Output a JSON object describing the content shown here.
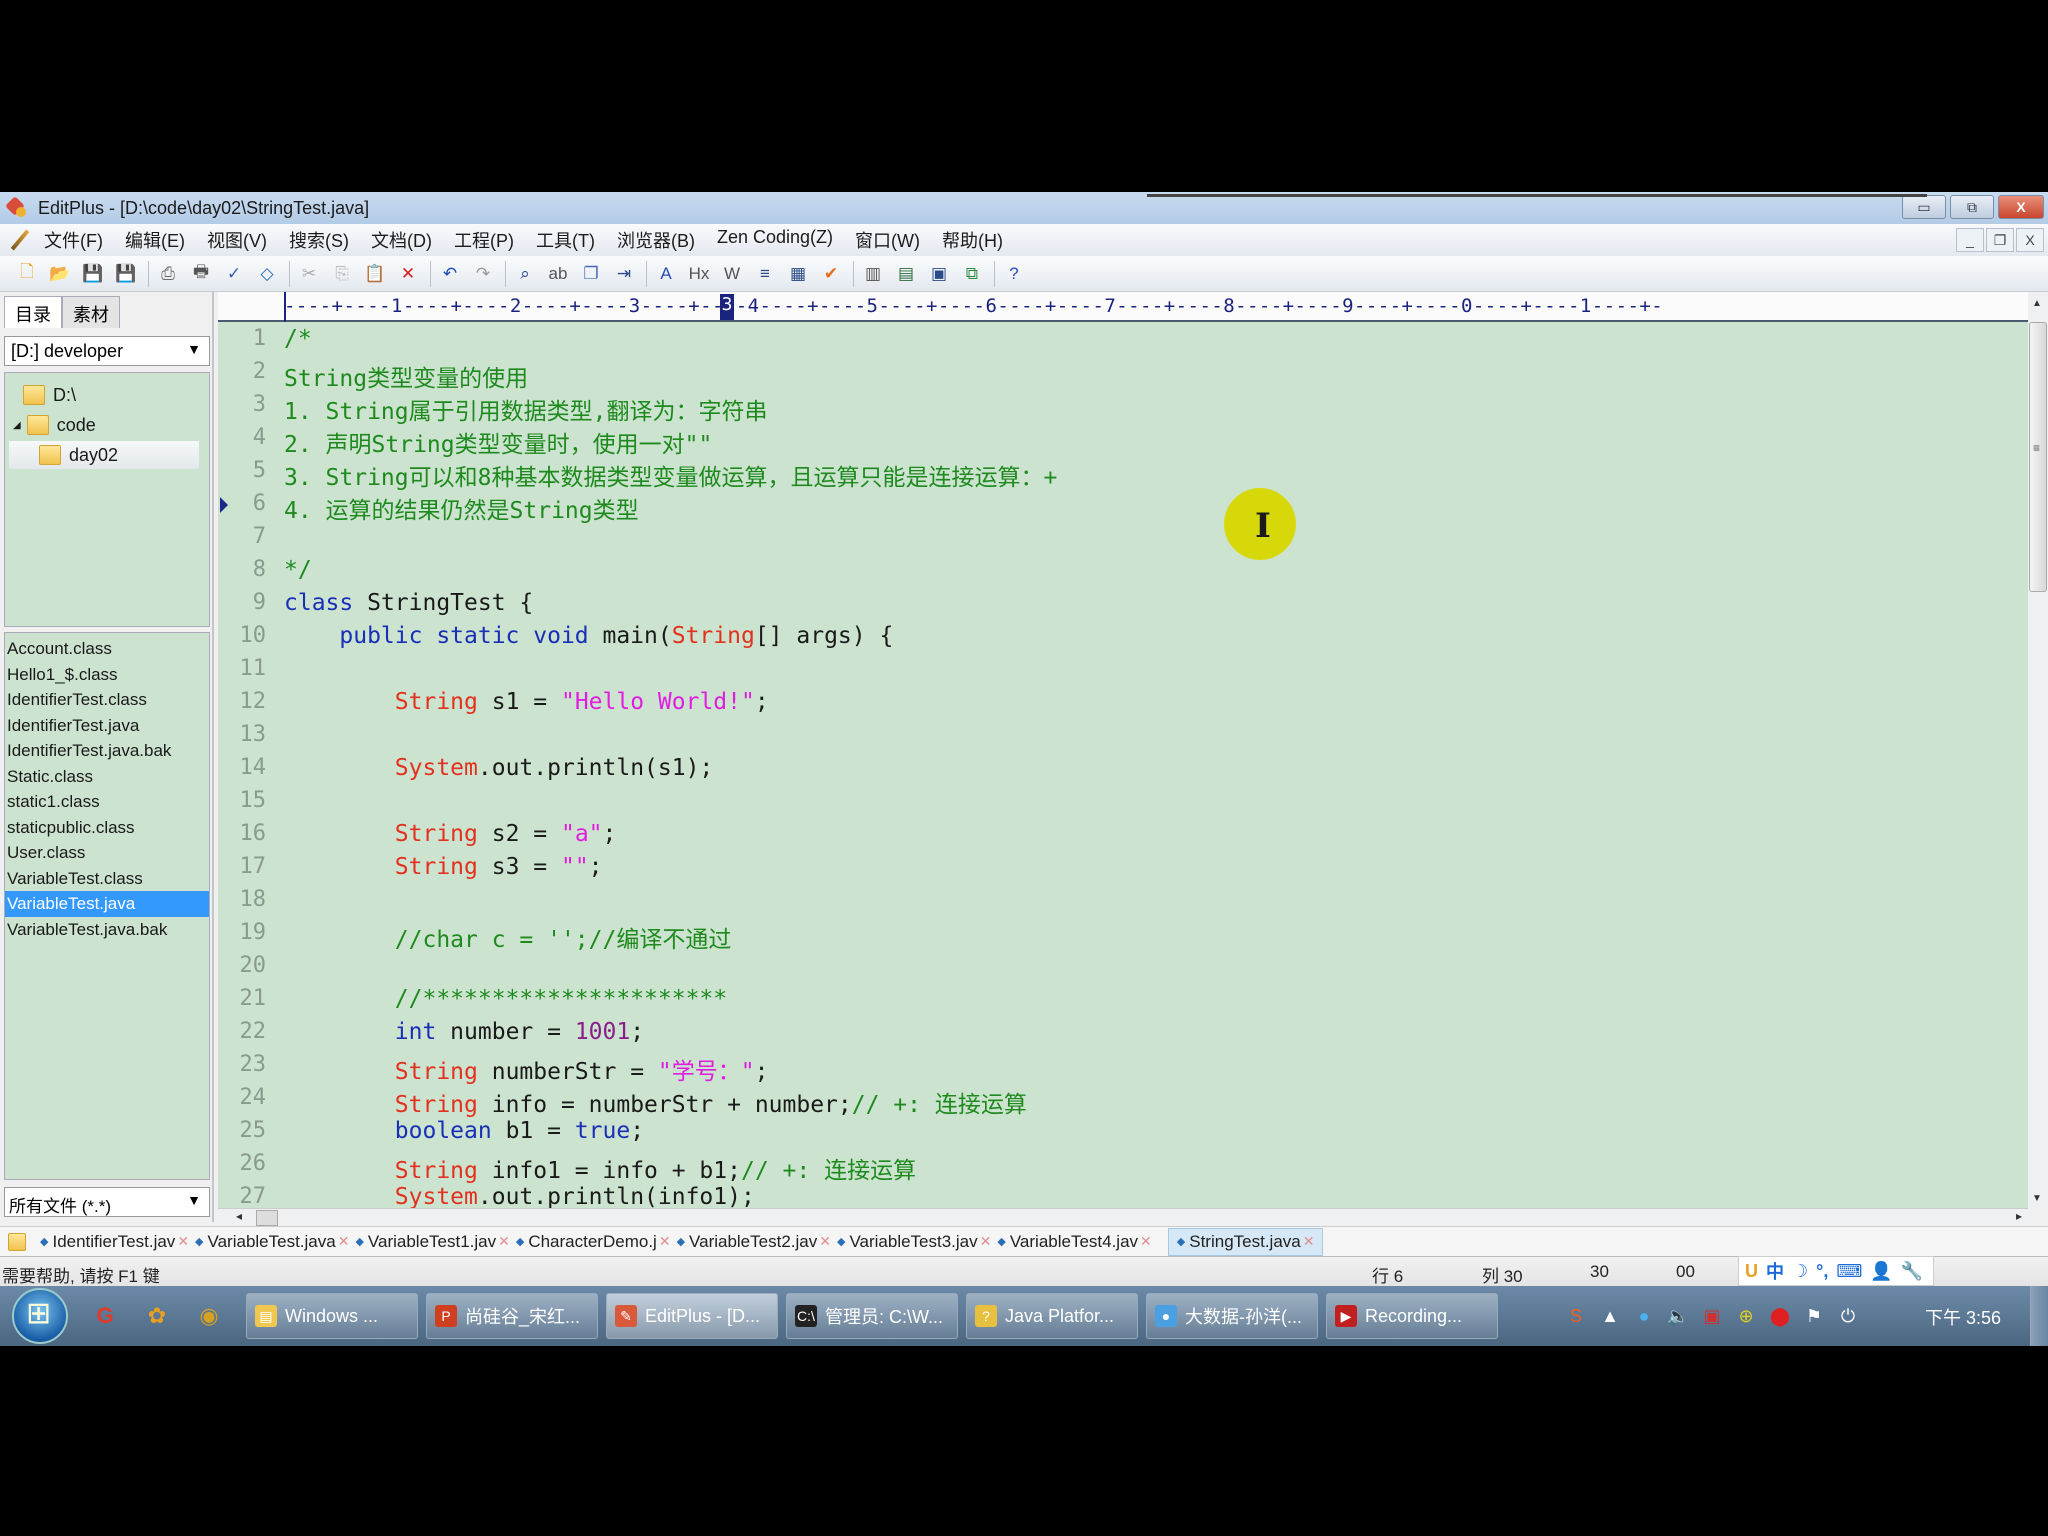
{
  "window": {
    "title": "EditPlus - [D:\\code\\day02\\StringTest.java]",
    "controls": {
      "minimize": "▭",
      "restore": "⧉",
      "close": "X"
    },
    "mdi_controls": {
      "minimize": "_",
      "restore": "❐",
      "close": "X"
    }
  },
  "menu": [
    "文件(F)",
    "编辑(E)",
    "视图(V)",
    "搜索(S)",
    "文档(D)",
    "工程(P)",
    "工具(T)",
    "浏览器(B)",
    "Zen Coding(Z)",
    "窗口(W)",
    "帮助(H)"
  ],
  "toolbar": [
    {
      "icon": "new-file-icon",
      "glyph": "🗋",
      "color": "#e6a820"
    },
    {
      "icon": "open-icon",
      "glyph": "📂",
      "color": "#e6b030"
    },
    {
      "icon": "save-icon",
      "glyph": "💾",
      "color": "#2a7a3a"
    },
    {
      "icon": "save-all-icon",
      "glyph": "💾",
      "color": "#3a8a4a"
    },
    {
      "sep": true
    },
    {
      "icon": "print-preview-icon",
      "glyph": "⎙",
      "color": "#666"
    },
    {
      "icon": "print-icon",
      "glyph": "🖶",
      "color": "#555"
    },
    {
      "icon": "spellcheck-icon",
      "glyph": "✓",
      "color": "#3a5ab8"
    },
    {
      "icon": "browser-preview-icon",
      "glyph": "◇",
      "color": "#2a6ab8"
    },
    {
      "sep": true
    },
    {
      "icon": "cut-icon",
      "glyph": "✂",
      "color": "#aaa"
    },
    {
      "icon": "copy-icon",
      "glyph": "⎘",
      "color": "#bbb"
    },
    {
      "icon": "paste-icon",
      "glyph": "📋",
      "color": "#444"
    },
    {
      "icon": "delete-icon",
      "glyph": "✕",
      "color": "#d02020"
    },
    {
      "sep": true
    },
    {
      "icon": "undo-icon",
      "glyph": "↶",
      "color": "#1a4ab8"
    },
    {
      "icon": "redo-icon",
      "glyph": "↷",
      "color": "#999"
    },
    {
      "sep": true
    },
    {
      "icon": "find-icon",
      "glyph": "⌕",
      "color": "#1a3a8a"
    },
    {
      "icon": "replace-icon",
      "glyph": "ab",
      "color": "#555"
    },
    {
      "icon": "find-in-files-icon",
      "glyph": "❐",
      "color": "#4a6ab8"
    },
    {
      "icon": "goto-line-icon",
      "glyph": "⇥",
      "color": "#2a4a8a"
    },
    {
      "sep": true
    },
    {
      "icon": "font-icon",
      "glyph": "A",
      "color": "#2a4ab8"
    },
    {
      "icon": "hex-icon",
      "glyph": "Hx",
      "color": "#555"
    },
    {
      "icon": "word-wrap-icon",
      "glyph": "W",
      "color": "#555"
    },
    {
      "icon": "line-numbers-icon",
      "glyph": "≡",
      "color": "#2a4a8a"
    },
    {
      "icon": "column-select-icon",
      "glyph": "▦",
      "color": "#2a4a8a"
    },
    {
      "icon": "check-icon",
      "glyph": "✔",
      "color": "#e07020"
    },
    {
      "sep": true
    },
    {
      "icon": "directory-window-icon",
      "glyph": "▥",
      "color": "#555"
    },
    {
      "icon": "cliptext-window-icon",
      "glyph": "▤",
      "color": "#2a6a3a"
    },
    {
      "icon": "output-window-icon",
      "glyph": "▣",
      "color": "#2a4a8a"
    },
    {
      "icon": "fullscreen-icon",
      "glyph": "⧉",
      "color": "#2a8a3a"
    },
    {
      "sep": true
    },
    {
      "icon": "help-icon",
      "glyph": "?",
      "color": "#2a4ab8"
    }
  ],
  "left_panel": {
    "tabs": [
      "目录",
      "素材"
    ],
    "drive": "[D:] developer",
    "tree": [
      {
        "label": "D:\\",
        "level": 0,
        "expanded": false,
        "selected": false
      },
      {
        "label": "code",
        "level": 1,
        "expanded": true,
        "selected": false
      },
      {
        "label": "day02",
        "level": 2,
        "expanded": false,
        "selected": true
      }
    ],
    "files": [
      "Account.class",
      "Hello1_$.class",
      "IdentifierTest.class",
      "IdentifierTest.java",
      "IdentifierTest.java.bak",
      "Static.class",
      "static1.class",
      "staticpublic.class",
      "User.class",
      "VariableTest.class",
      "VariableTest.java",
      "VariableTest.java.bak"
    ],
    "selected_file": "VariableTest.java",
    "filter": "所有文件 (*.*)"
  },
  "ruler": {
    "text": "----+----1----+----2----+----3----+----4----+----5----+----6----+----7----+----8----+----9----+----0----+----1----+-",
    "current_column_mark": "3"
  },
  "editor": {
    "current_line": 6,
    "lines": [
      {
        "n": "1",
        "tokens": [
          {
            "t": "/*",
            "c": "cmt"
          }
        ]
      },
      {
        "n": "2",
        "tokens": [
          {
            "t": "String类型变量的使用",
            "c": "cmt"
          }
        ]
      },
      {
        "n": "3",
        "tokens": [
          {
            "t": "1. String属于引用数据类型,翻译为：字符串",
            "c": "cmt"
          }
        ]
      },
      {
        "n": "4",
        "tokens": [
          {
            "t": "2. 声明String类型变量时，使用一对\"\"",
            "c": "cmt"
          }
        ]
      },
      {
        "n": "5",
        "tokens": [
          {
            "t": "3. String可以和8种基本数据类型变量做运算，且运算只能是连接运算：+",
            "c": "cmt"
          }
        ]
      },
      {
        "n": "6",
        "tokens": [
          {
            "t": "4. 运算的结果仍然是String类型",
            "c": "cmt"
          }
        ]
      },
      {
        "n": "7",
        "tokens": []
      },
      {
        "n": "8",
        "tokens": [
          {
            "t": "*/",
            "c": "cmt"
          }
        ]
      },
      {
        "n": "9",
        "tokens": [
          {
            "t": "class",
            "c": "kw"
          },
          {
            "t": " StringTest {",
            "c": "plain"
          }
        ]
      },
      {
        "n": "10",
        "tokens": [
          {
            "t": "    ",
            "c": "plain"
          },
          {
            "t": "public static void",
            "c": "kw"
          },
          {
            "t": " main(",
            "c": "plain"
          },
          {
            "t": "String",
            "c": "ty"
          },
          {
            "t": "[] args) {",
            "c": "plain"
          }
        ]
      },
      {
        "n": "11",
        "tokens": []
      },
      {
        "n": "12",
        "tokens": [
          {
            "t": "        ",
            "c": "plain"
          },
          {
            "t": "String",
            "c": "ty"
          },
          {
            "t": " s1 = ",
            "c": "plain"
          },
          {
            "t": "\"Hello World!\"",
            "c": "str"
          },
          {
            "t": ";",
            "c": "plain"
          }
        ]
      },
      {
        "n": "13",
        "tokens": []
      },
      {
        "n": "14",
        "tokens": [
          {
            "t": "        ",
            "c": "plain"
          },
          {
            "t": "System",
            "c": "ty"
          },
          {
            "t": ".out.println(s1);",
            "c": "plain"
          }
        ]
      },
      {
        "n": "15",
        "tokens": []
      },
      {
        "n": "16",
        "tokens": [
          {
            "t": "        ",
            "c": "plain"
          },
          {
            "t": "String",
            "c": "ty"
          },
          {
            "t": " s2 = ",
            "c": "plain"
          },
          {
            "t": "\"a\"",
            "c": "str"
          },
          {
            "t": ";",
            "c": "plain"
          }
        ]
      },
      {
        "n": "17",
        "tokens": [
          {
            "t": "        ",
            "c": "plain"
          },
          {
            "t": "String",
            "c": "ty"
          },
          {
            "t": " s3 = ",
            "c": "plain"
          },
          {
            "t": "\"\"",
            "c": "str"
          },
          {
            "t": ";",
            "c": "plain"
          }
        ]
      },
      {
        "n": "18",
        "tokens": []
      },
      {
        "n": "19",
        "tokens": [
          {
            "t": "        ",
            "c": "plain"
          },
          {
            "t": "//char c = '';//编译不通过",
            "c": "cmt"
          }
        ]
      },
      {
        "n": "20",
        "tokens": []
      },
      {
        "n": "21",
        "tokens": [
          {
            "t": "        ",
            "c": "plain"
          },
          {
            "t": "//**********************",
            "c": "cmt"
          }
        ]
      },
      {
        "n": "22",
        "tokens": [
          {
            "t": "        ",
            "c": "plain"
          },
          {
            "t": "int",
            "c": "kw"
          },
          {
            "t": " number = ",
            "c": "plain"
          },
          {
            "t": "1001",
            "c": "num"
          },
          {
            "t": ";",
            "c": "plain"
          }
        ]
      },
      {
        "n": "23",
        "tokens": [
          {
            "t": "        ",
            "c": "plain"
          },
          {
            "t": "String",
            "c": "ty"
          },
          {
            "t": " numberStr = ",
            "c": "plain"
          },
          {
            "t": "\"学号：\"",
            "c": "str"
          },
          {
            "t": ";",
            "c": "plain"
          }
        ]
      },
      {
        "n": "24",
        "tokens": [
          {
            "t": "        ",
            "c": "plain"
          },
          {
            "t": "String",
            "c": "ty"
          },
          {
            "t": " info = numberStr + number;",
            "c": "plain"
          },
          {
            "t": "// +: 连接运算",
            "c": "cmt"
          }
        ]
      },
      {
        "n": "25",
        "tokens": [
          {
            "t": "        ",
            "c": "plain"
          },
          {
            "t": "boolean",
            "c": "kw"
          },
          {
            "t": " b1 = ",
            "c": "plain"
          },
          {
            "t": "true",
            "c": "kw"
          },
          {
            "t": ";",
            "c": "plain"
          }
        ]
      },
      {
        "n": "26",
        "tokens": [
          {
            "t": "        ",
            "c": "plain"
          },
          {
            "t": "String",
            "c": "ty"
          },
          {
            "t": " info1 = info + b1;",
            "c": "plain"
          },
          {
            "t": "// +: 连接运算",
            "c": "cmt"
          }
        ]
      },
      {
        "n": "27",
        "tokens": [
          {
            "t": "        ",
            "c": "plain"
          },
          {
            "t": "System",
            "c": "ty"
          },
          {
            "t": ".out.println(info1);",
            "c": "plain"
          }
        ]
      }
    ]
  },
  "doc_tabs": [
    {
      "label": "IdentifierTest.jav",
      "active": false
    },
    {
      "label": "VariableTest.java",
      "active": false
    },
    {
      "label": "VariableTest1.jav",
      "active": false
    },
    {
      "label": "CharacterDemo.j",
      "active": false
    },
    {
      "label": "VariableTest2.jav",
      "active": false
    },
    {
      "label": "VariableTest3.jav",
      "active": false
    },
    {
      "label": "VariableTest4.jav",
      "active": false
    },
    {
      "label": "StringTest.java",
      "active": true
    }
  ],
  "status": {
    "help": "需要帮助, 请按 F1 键",
    "line": "行 6",
    "col": "列 30",
    "sel": "30",
    "code": "00"
  },
  "ime": [
    "U",
    "中",
    "☽",
    "°,",
    "⌨",
    "👤",
    "🔧"
  ],
  "taskbar": {
    "quick_launch": [
      {
        "name": "quick-launch-app-1",
        "glyph": "G",
        "color": "#e03a2a"
      },
      {
        "name": "quick-launch-app-2",
        "glyph": "✿",
        "color": "#e8a020"
      },
      {
        "name": "chrome-icon",
        "glyph": "◉",
        "color": "#d8a020"
      }
    ],
    "tasks": [
      {
        "label": "Windows ...",
        "icon": "folder-icon",
        "glyph": "▤",
        "bg": "#f0c850",
        "active": false
      },
      {
        "label": "尚硅谷_宋红...",
        "icon": "powerpoint-icon",
        "glyph": "P",
        "bg": "#d04020",
        "active": false
      },
      {
        "label": "EditPlus - [D...",
        "icon": "editplus-icon",
        "glyph": "✎",
        "bg": "#d85a3a",
        "active": true
      },
      {
        "label": "管理员: C:\\W...",
        "icon": "cmd-icon",
        "glyph": "C:\\",
        "bg": "#222",
        "active": false
      },
      {
        "label": "Java Platfor...",
        "icon": "help-doc-icon",
        "glyph": "?",
        "bg": "#e8c040",
        "active": false
      },
      {
        "label": "大数据-孙洋(...",
        "icon": "chat-icon",
        "glyph": "●",
        "bg": "#4aa0e0",
        "active": false
      },
      {
        "label": "Recording...",
        "icon": "recording-icon",
        "glyph": "▶",
        "bg": "#c02020",
        "active": false
      }
    ],
    "tray": [
      {
        "name": "sogou-ime-icon",
        "glyph": "S",
        "color": "#f06020"
      },
      {
        "name": "show-hidden-icon",
        "glyph": "▲",
        "color": "#fff"
      },
      {
        "name": "messenger-tray-icon",
        "glyph": "●",
        "color": "#4ab0f0"
      },
      {
        "name": "volume-icon",
        "glyph": "🔈",
        "color": "#fff"
      },
      {
        "name": "network-icon",
        "glyph": "▣",
        "color": "#d03030"
      },
      {
        "name": "tray-app-icon",
        "glyph": "⊕",
        "color": "#e0d020"
      },
      {
        "name": "record-stop-icon",
        "glyph": "⬤",
        "color": "#e02020"
      },
      {
        "name": "action-center-icon",
        "glyph": "⚑",
        "color": "#fff"
      },
      {
        "name": "power-icon",
        "glyph": "⏻",
        "color": "#fff"
      }
    ],
    "clock": "下午 3:56"
  }
}
